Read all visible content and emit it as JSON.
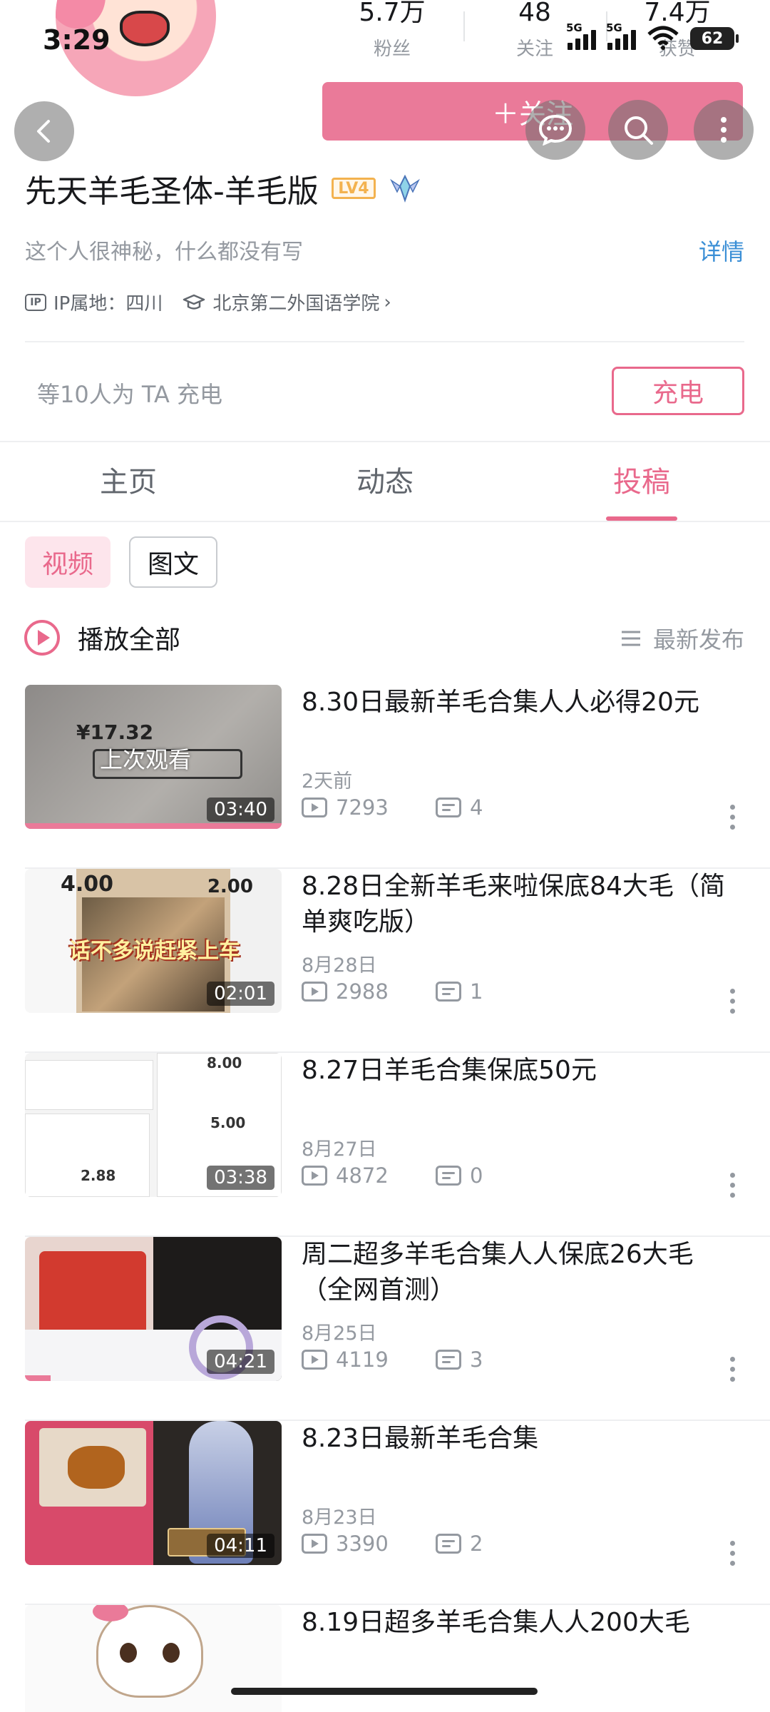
{
  "status_bar": {
    "time": "3:29",
    "signal1": "5G",
    "signal2": "5G",
    "battery": "62"
  },
  "profile": {
    "stats": [
      {
        "value": "5.7万",
        "label": "粉丝"
      },
      {
        "value": "48",
        "label": "关注"
      },
      {
        "value": "7.4万",
        "label": "获赞"
      }
    ],
    "follow_label": "＋关注",
    "name": "先天羊毛圣体-羊毛版",
    "level": "LV4",
    "bio": "这个人很神秘，什么都没有写",
    "detail_link": "详情",
    "ip_tag": "IP",
    "ip_location": "IP属地：四川",
    "school": "北京第二外国语学院",
    "charge_text": "等10人为 TA 充电",
    "charge_button": "充电"
  },
  "tabs": [
    {
      "label": "主页",
      "active": false
    },
    {
      "label": "动态",
      "active": false
    },
    {
      "label": "投稿",
      "active": true
    }
  ],
  "filters": [
    {
      "label": "视频",
      "active": true
    },
    {
      "label": "图文",
      "active": false
    }
  ],
  "play_all": "播放全部",
  "sort_label": "最新发布",
  "videos": [
    {
      "title": "8.30日最新羊毛合集人人必得20元",
      "date": "2天前",
      "views": "7293",
      "comments": "4",
      "duration": "03:40",
      "last_watched": "上次观看",
      "progress": 1.0
    },
    {
      "title": "8.28日全新羊毛来啦保底84大毛（简单爽吃版）",
      "date": "8月28日",
      "views": "2988",
      "comments": "1",
      "duration": "02:01"
    },
    {
      "title": "8.27日羊毛合集保底50元",
      "date": "8月27日",
      "views": "4872",
      "comments": "0",
      "duration": "03:38"
    },
    {
      "title": "周二超多羊毛合集人人保底26大毛（全网首测）",
      "date": "8月25日",
      "views": "4119",
      "comments": "3",
      "duration": "04:21",
      "progress": 0.1
    },
    {
      "title": "8.23日最新羊毛合集",
      "date": "8月23日",
      "views": "3390",
      "comments": "2",
      "duration": "04:11"
    },
    {
      "title": "8.19日超多羊毛合集人人200大毛"
    }
  ],
  "thumb_text": {
    "t1_amount": "¥17.32",
    "t2_n1": "4.00",
    "t2_n2": "2.00",
    "t2_caption": "话不多说赶紧上车",
    "t3_n1": "8.00",
    "t3_n2": "5.00",
    "t3_n3": "2.88"
  },
  "colors": {
    "accent": "#e9698c",
    "follow_bg": "#ea7a99",
    "link": "#3b8fd6"
  }
}
